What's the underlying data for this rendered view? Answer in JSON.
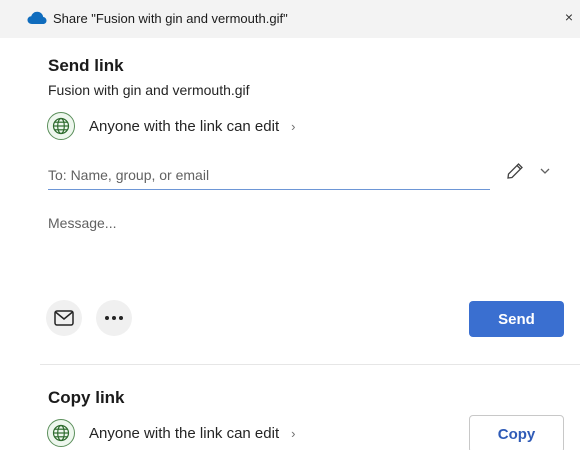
{
  "window": {
    "title": "Share \"Fusion with gin and vermouth.gif\"",
    "close_label": "×",
    "icon": "onedrive-cloud-icon"
  },
  "send_link": {
    "heading": "Send link",
    "file_name": "Fusion with gin and vermouth.gif",
    "permission": "Anyone with the link can edit",
    "permission_chevron": "›",
    "to_placeholder": "To: Name, group, or email",
    "to_value": "",
    "message_placeholder": "Message...",
    "send_label": "Send",
    "icons": [
      "globe-icon",
      "pencil-icon",
      "chevron-down-icon",
      "mail-icon",
      "more-icon"
    ]
  },
  "copy_link": {
    "heading": "Copy link",
    "permission": "Anyone with the link can edit",
    "permission_chevron": "›",
    "copy_label": "Copy"
  },
  "colors": {
    "accent": "#3a6fd0",
    "title_bar": "#f3f3f3",
    "globe_ring": "#5b8f5b"
  }
}
